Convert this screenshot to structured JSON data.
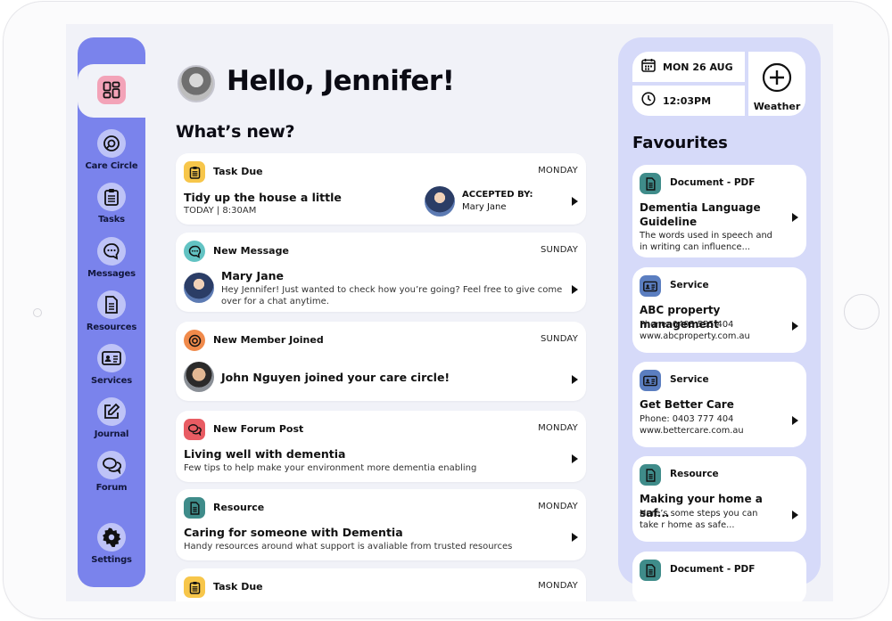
{
  "greeting": "Hello, Jennifer!",
  "section_title": "What’s new?",
  "sidebar": {
    "home_icon": "dashboard-icon",
    "items": [
      {
        "label": "Care Circle",
        "icon": "target-icon"
      },
      {
        "label": "Tasks",
        "icon": "clipboard-icon"
      },
      {
        "label": "Messages",
        "icon": "chat-icon"
      },
      {
        "label": "Resources",
        "icon": "document-icon"
      },
      {
        "label": "Services",
        "icon": "id-card-icon"
      },
      {
        "label": "Journal",
        "icon": "edit-icon"
      },
      {
        "label": "Forum",
        "icon": "forum-icon"
      },
      {
        "label": "Settings",
        "icon": "gear-icon"
      }
    ]
  },
  "feed": [
    {
      "type": "Task Due",
      "day": "MONDAY",
      "title": "Tidy up the house a little",
      "sub": "TODAY | 8:30AM",
      "accepted_label": "ACCEPTED BY:",
      "accepted_name": "Mary Jane",
      "color": "#f7c64a"
    },
    {
      "type": "New Message",
      "day": "SUNDAY",
      "title": "Mary Jane",
      "sub": "Hey Jennifer! Just wanted to check how you’re going? Feel free to give come over for a chat anytime.",
      "color": "#62c3c3"
    },
    {
      "type": "New Member Joined",
      "day": "SUNDAY",
      "title": "John Nguyen joined your care circle!",
      "color": "#f08a4b"
    },
    {
      "type": "New Forum Post",
      "day": "MONDAY",
      "title": "Living well with dementia",
      "sub": "Few tips to help make your environment more dementia enabling",
      "color": "#e85c63"
    },
    {
      "type": "Resource",
      "day": "MONDAY",
      "title": "Caring for someone with Dementia",
      "sub": "Handy resources around what support is avaliable from trusted resources",
      "color": "#3f8c8a"
    },
    {
      "type": "Task Due",
      "day": "MONDAY",
      "color": "#f7c64a"
    }
  ],
  "info": {
    "date": "MON 26 AUG",
    "time": "12:03PM",
    "weather_label": "Weather"
  },
  "favourites_title": "Favourites",
  "favourites": [
    {
      "type": "Document - PDF",
      "title": "Dementia Language Guideline",
      "sub": "The words used in speech and in writing can influence...",
      "color": "#3f8c8a"
    },
    {
      "type": "Service",
      "title": "ABC property management",
      "sub": "Phone: 0403 555 404\nwww.abcproperty.com.au",
      "color": "#5b7ec0"
    },
    {
      "type": "Service",
      "title": "Get Better Care",
      "sub": "Phone: 0403 777 404\nwww.bettercare.com.au",
      "color": "#5b7ec0"
    },
    {
      "type": "Resource",
      "title": "Making your home a saf...",
      "sub": "Here’s some steps you can take r home as safe...",
      "color": "#3f8c8a"
    },
    {
      "type": "Document - PDF",
      "color": "#3f8c8a"
    }
  ]
}
